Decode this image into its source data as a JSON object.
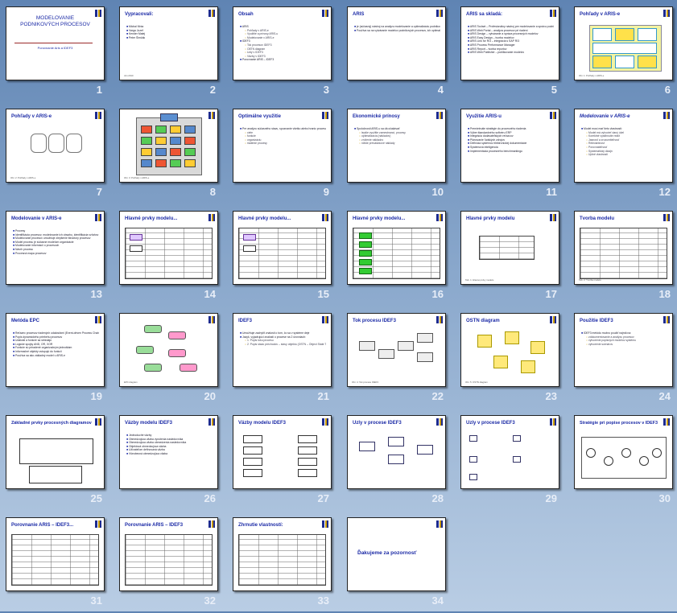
{
  "slides": [
    {
      "n": "1",
      "title": "MODELOVANIE PODNIKOVÝCH PROCESOV",
      "subtitle": "Porovnanie Aris a IDEF3",
      "kind": "title"
    },
    {
      "n": "2",
      "title": "Vypracovali:",
      "bullets": [
        "Michal Mráz",
        "Varga Jozef",
        "Kender Matej",
        "Peter Šimčák"
      ],
      "foot": "Jún 2010"
    },
    {
      "n": "3",
      "title": "Obsah",
      "bullets": [
        "ARIS",
        "Pohľady v ARIS-e",
        "Využitie a prínosy ARIS-u",
        "Modelovanie v ARIS-e",
        "IDEF3",
        "Tok procesov IDEF3",
        "O8TN diagram",
        "Uzly v IDEF3",
        "Väzby v IDEF3",
        "Porovnanie ARIS – IDEF3"
      ]
    },
    {
      "n": "4",
      "title": "ARIS",
      "bullets": [
        "je (súčasný) nástroj na analýzu modelovanie a optimalizáciu podnikových procesov.",
        "Používa sa na vytváranie modelov podnikových procesov, ich optimalizáciu a následné použitie v rôznych projektoch"
      ]
    },
    {
      "n": "5",
      "title": "ARIS sa skladá:",
      "bullets": [
        "ARIS Toolset – Profesionálny nástroj pre modelovanie a správu podnikových procesov",
        "ARIS Web Portal – analýza procesov pri riadení",
        "ARIS Design – vytváranie a správa procesných modelov",
        "ARIS Easy Design – tvorba modelov",
        "ARIS Link for R/3 – integrácia s SAP R/3",
        "ARIS Process Performance Manager",
        "ARIS Report – tvorba reportov",
        "ARIS Web Publisher – publikovanie modelov"
      ]
    },
    {
      "n": "6",
      "title": "Pohľady v ARIS-e",
      "foot": "Obr. 1: Pohľady v ARIS-e",
      "kind": "aris-house"
    },
    {
      "n": "7",
      "title": "Pohľady v ARIS-e",
      "foot": "Obr. 2: Pohľady v ARIS-e",
      "kind": "cylinders"
    },
    {
      "n": "8",
      "title": "",
      "foot": "Obr. 3: Pohľady v ARIS-e",
      "kind": "house2"
    },
    {
      "n": "9",
      "title": "Optimálne využitie",
      "bullets": [
        "Pre analýzu súčasného stavu, spoznanie všetko alebo hranic procesov, jeho okolia. ARIS-u nám poskytne model procesov samotného pohľadu na:",
        "ciele",
        "funkcie",
        "organizáciu",
        "riadenie procesy"
      ]
    },
    {
      "n": "10",
      "title": "Ekonomické prínosy",
      "bullets": [
        "Spoločnosti ARIS-u sa dá očakávať:",
        "lepšie využitie zamestnanci, procesy",
        "optimalizácia (nákladov)",
        "zníženie nákladov",
        "nižšie prevádzkové náklady"
      ]
    },
    {
      "n": "11",
      "title": "Využitie ARIS-u",
      "bullets": [
        "Premietnutie stratégie do procesného riadenia",
        "Výber štandardného softvéru ERP",
        "Integrácia dodávateľských reťazcov",
        "Plánovanie ľudských zdrojov",
        "Definícia systémov elektronickej dokumentácie",
        "Systémová inteligencia",
        "Implementácia procesného benchmarkingu"
      ]
    },
    {
      "n": "12",
      "title": "Modelovanie v ARIS-e",
      "italic": true,
      "bullets": [
        "Model musí mať tieto vlastnosti:",
        "Model má vyhovieť daný účel",
        "Korektné vystihnutie realít",
        "Jasnosť a zrozumiteľnosť",
        "Relevantnosť",
        "Porovnateľnosť",
        "Systematický dizajn",
        "Úplné vlastnosti"
      ]
    },
    {
      "n": "13",
      "title": "Modelovanie v ARIS-e",
      "bullets": [
        "Procesy",
        "Identifikácia procesov, modelovanie ich obsahu, identifikácia vzťahov medzi nimi",
        "Modelovanie procesov umožňuje zlepšenie štruktúry procesov",
        "Model procesu je súčasne modelom organizácie",
        "Modelovanie informácií o procesoch",
        "Návrh procesu",
        "Procesná mapa procesov"
      ]
    },
    {
      "n": "14",
      "title": "Hlavné prvky modelu...",
      "kind": "table"
    },
    {
      "n": "15",
      "title": "Hlavné prvky modelu...",
      "kind": "table"
    },
    {
      "n": "16",
      "title": "Hlavné prvky modelu...",
      "kind": "table-green"
    },
    {
      "n": "17",
      "title": "Hlavné prvky modelu",
      "foot": "Tab. 1: Hlavné prvky modelu",
      "kind": "table-small"
    },
    {
      "n": "18",
      "title": "Tvorba modelu",
      "foot": "Tab. 2: Tvorba modelu",
      "kind": "table-icons"
    },
    {
      "n": "19",
      "title": "Metóda EPC",
      "bullets": [
        "Reťazec procesov riadených udalosťami (Event-driven Process Chain)",
        "Popis dynamického priebehu procesov",
        "Udalosti a funkcie sa striedajú",
        "Logické spojky AND, OR, XOR",
        "Funkcie sú priradené organizačným jednotkám",
        "Informačné objekty vstupujú do funkcií",
        "Používa sa ako základný model v ARIS-e"
      ]
    },
    {
      "n": "20",
      "title": "",
      "foot": "EPC diagram",
      "kind": "epc"
    },
    {
      "n": "21",
      "title": "IDEF3",
      "bullets": [
        "Umožňuje zachytiť znalosti o tom, čo sa v systéme deje",
        "Jazyk, vyjadrujúci znalosti o procese na 2 úrovniach:",
        "1. Popis toku procesu",
        "2. Popis stavu prechodov – stavy objektu (OSTN – Object State Transition Network description)"
      ]
    },
    {
      "n": "22",
      "title": "Tok procesu IDEF3",
      "foot": "Obr. 4: Tok procesu IDEF3",
      "kind": "flow"
    },
    {
      "n": "23",
      "title": "OSTN diagram",
      "foot": "Obr. 5: OSTN diagram",
      "kind": "ostn"
    },
    {
      "n": "24",
      "title": "Použitie IDEF3",
      "bullets": [
        "IDEF3 metódu možno použiť najmä na:",
        "zdokumentovanie a analýzu procesov",
        "vytvorenie popisných modelov systému",
        "vytvorenie scenárov"
      ]
    },
    {
      "n": "25",
      "title": "Základné prvky procesných diagramov",
      "kind": "elements"
    },
    {
      "n": "26",
      "title": "Väzby modelu IDEF3",
      "bullets": [
        "Jednoduché väzby",
        "Obmedzujúca väzba vynútenia nasledovníka",
        "Obmedzujúca väzba obmedzenia nasledovníka",
        "Objektová obmedzujúca väzba",
        "Užívateľom definovaná väzba",
        "Všeobecná obmedzujúca väzba"
      ]
    },
    {
      "n": "27",
      "title": "Väzby modelu IDEF3",
      "kind": "links"
    },
    {
      "n": "28",
      "title": "Uzly v procese IDEF3",
      "kind": "nodes"
    },
    {
      "n": "29",
      "title": "Uzly v procese IDEF3",
      "kind": "nodes2"
    },
    {
      "n": "30",
      "title": "Stratégie pri popise procesov v IDEF3",
      "kind": "strategy"
    },
    {
      "n": "31",
      "title": "Porovnanie ARIS – IDEF3...",
      "kind": "table"
    },
    {
      "n": "32",
      "title": "Porovnanie ARIS – IDEF3",
      "kind": "table"
    },
    {
      "n": "33",
      "title": "Zhrnutie vlastností:",
      "kind": "table"
    },
    {
      "n": "34",
      "title": "",
      "thanks": "Ďakujeme za pozornosť",
      "kind": "thanks"
    }
  ]
}
